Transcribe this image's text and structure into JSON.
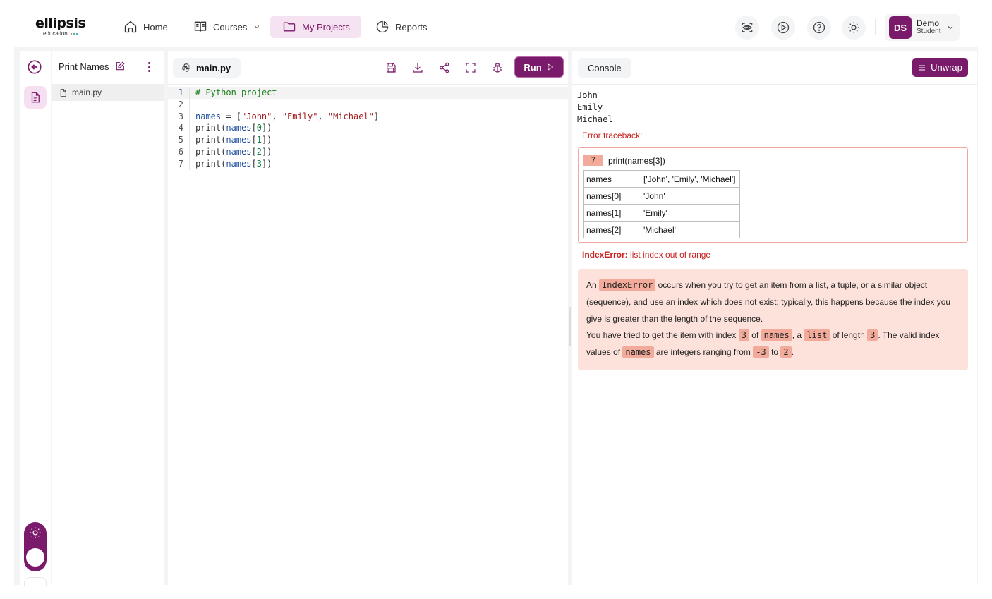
{
  "brand": {
    "name": "ellipsis",
    "sub": "education",
    "dot_colors": [
      "#e83e8c",
      "#28a745",
      "#1e88e5"
    ]
  },
  "nav": {
    "home": "Home",
    "courses": "Courses",
    "projects": "My Projects",
    "reports": "Reports"
  },
  "user": {
    "initials": "DS",
    "name": "Demo",
    "role": "Student"
  },
  "project": {
    "name": "Print Names",
    "files": [
      "main.py"
    ]
  },
  "editor": {
    "tab": "main.py",
    "run_label": "Run",
    "lines": [
      {
        "n": "1",
        "tokens": [
          [
            "comment",
            "# Python project"
          ]
        ]
      },
      {
        "n": "2",
        "tokens": []
      },
      {
        "n": "3",
        "tokens": [
          [
            "name",
            "names"
          ],
          [
            "plain",
            " = ["
          ],
          [
            "str",
            "\"John\""
          ],
          [
            "plain",
            ", "
          ],
          [
            "str",
            "\"Emily\""
          ],
          [
            "plain",
            ", "
          ],
          [
            "str",
            "\"Michael\""
          ],
          [
            "plain",
            "]"
          ]
        ]
      },
      {
        "n": "4",
        "tokens": [
          [
            "plain",
            "print("
          ],
          [
            "name",
            "names"
          ],
          [
            "plain",
            "["
          ],
          [
            "num",
            "0"
          ],
          [
            "plain",
            "])"
          ]
        ]
      },
      {
        "n": "5",
        "tokens": [
          [
            "plain",
            "print("
          ],
          [
            "name",
            "names"
          ],
          [
            "plain",
            "["
          ],
          [
            "num",
            "1"
          ],
          [
            "plain",
            "])"
          ]
        ]
      },
      {
        "n": "6",
        "tokens": [
          [
            "plain",
            "print("
          ],
          [
            "name",
            "names"
          ],
          [
            "plain",
            "["
          ],
          [
            "num",
            "2"
          ],
          [
            "plain",
            "])"
          ]
        ]
      },
      {
        "n": "7",
        "tokens": [
          [
            "plain",
            "print("
          ],
          [
            "name",
            "names"
          ],
          [
            "plain",
            "["
          ],
          [
            "num",
            "3"
          ],
          [
            "plain",
            "])"
          ]
        ]
      }
    ]
  },
  "console": {
    "tab": "Console",
    "unwrap_label": "Unwrap",
    "output": [
      "John",
      "Emily",
      "Michael"
    ],
    "traceback_title": "Error traceback:",
    "traceback_line_no": "7",
    "traceback_code": "print(names[3])",
    "variables": [
      {
        "name": "names",
        "value": "['John', 'Emily', 'Michael']"
      },
      {
        "name": "names[0]",
        "value": "'John'"
      },
      {
        "name": "names[1]",
        "value": "'Emily'"
      },
      {
        "name": "names[2]",
        "value": "'Michael'"
      }
    ],
    "error_type": "IndexError:",
    "error_message": "list index out of range",
    "explanation": {
      "p1_prefix": "An",
      "p1_code": "IndexError",
      "p1_text": "occurs when you try to get an item from a list, a tuple, or a similar object (sequence), and use an index which does not exist; typically, this happens because the index you give is greater than the length of the sequence.",
      "p2_a": "You have tried to get the item with index",
      "p2_index": "3",
      "p2_b": "of",
      "p2_var": "names",
      "p2_c": ", a",
      "p2_type": "list",
      "p2_d": "of length",
      "p2_len": "3",
      "p2_e": ". The valid index values of",
      "p2_var2": "names",
      "p2_f": "are integers ranging from",
      "p2_min": "-3",
      "p2_g": "to",
      "p2_max": "2",
      "p2_h": "."
    }
  },
  "colors": {
    "accent": "#7a1a6b",
    "accent_light": "#f6e3f1",
    "error": "#cc1f1f",
    "error_bg": "#fde2dc",
    "highlight": "#f2ab9a"
  }
}
